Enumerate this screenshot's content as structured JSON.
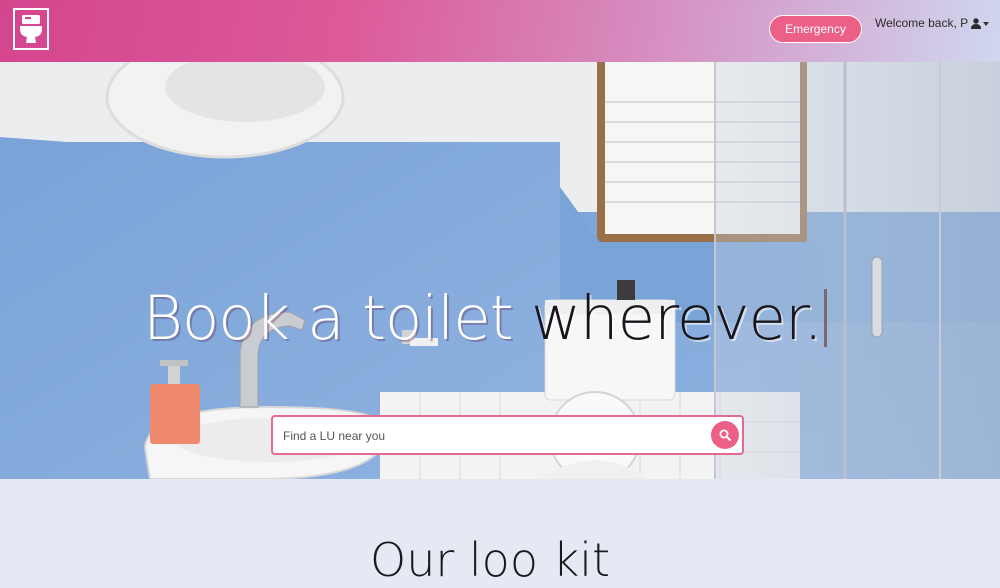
{
  "navbar": {
    "logo_icon": "toilet-icon",
    "emergency_label": "Emergency",
    "welcome_text": "Welcome back, P",
    "user_icon": "user-icon",
    "dropdown_icon": "caret-down-icon"
  },
  "hero": {
    "headline_prefix": "Book a toilet ",
    "headline_highlight": "wherever.",
    "search_placeholder": "Find a LU near you",
    "search_icon": "search-icon"
  },
  "colors": {
    "accent": "#ec5f86",
    "nav_gradient_start": "#d4458e",
    "nav_gradient_end": "#cfd7ee",
    "section_bg": "#e6e9f3"
  },
  "section": {
    "title": "Our loo kit"
  }
}
